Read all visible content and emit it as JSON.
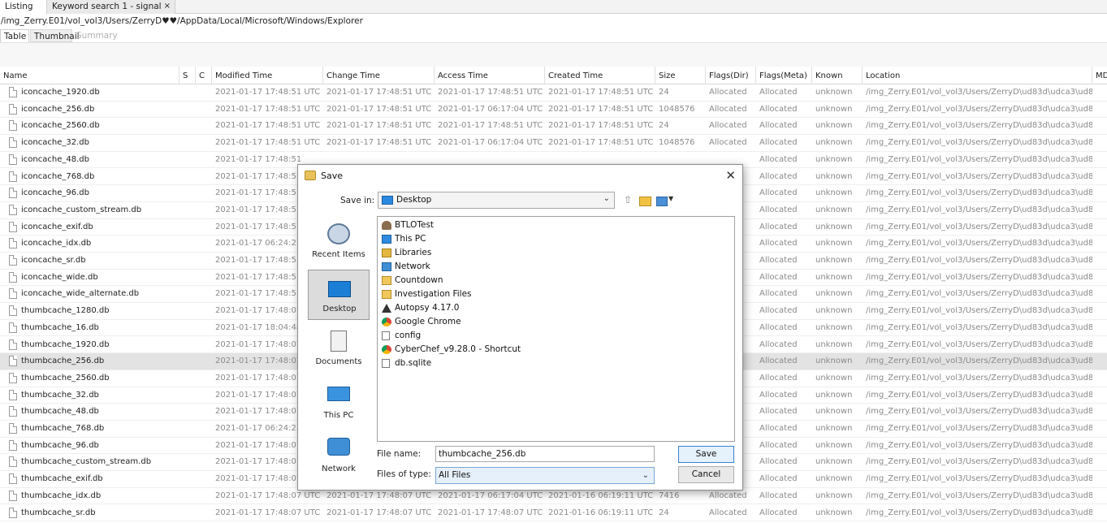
{
  "tabs": [
    {
      "label": "Listing"
    },
    {
      "label": "Keyword search 1 - signal"
    }
  ],
  "tab_close": "×",
  "path": "/img_Zerry.E01/vol_vol3/Users/ZerryD♥♥/AppData/Local/Microsoft/Windows/Explorer",
  "view_tabs": [
    "Table",
    "Thumbnail",
    "Summary"
  ],
  "columns": [
    "Name",
    "S",
    "C",
    "Modified Time",
    "Change Time",
    "Access Time",
    "Created Time",
    "Size",
    "Flags(Dir)",
    "Flags(Meta)",
    "Known",
    "Location",
    "MD"
  ],
  "rows": [
    {
      "name": "iconcache_1920.db",
      "mod": "2021-01-17 17:48:51 UTC",
      "chg": "2021-01-17 17:48:51 UTC",
      "acc": "2021-01-17 17:48:51 UTC",
      "cre": "2021-01-17 17:48:51 UTC",
      "size": "24",
      "fdir": "Allocated",
      "fmeta": "Allocated",
      "known": "unknown",
      "loc": "/img_Zerry.E01/vol_vol3/Users/ZerryD\\ud83d\\udca3\\ud83..."
    },
    {
      "name": "iconcache_256.db",
      "mod": "2021-01-17 17:48:51 UTC",
      "chg": "2021-01-17 17:48:51 UTC",
      "acc": "2021-01-17 06:17:04 UTC",
      "cre": "2021-01-17 17:48:51 UTC",
      "size": "1048576",
      "fdir": "Allocated",
      "fmeta": "Allocated",
      "known": "unknown",
      "loc": "/img_Zerry.E01/vol_vol3/Users/ZerryD\\ud83d\\udca3\\ud83..."
    },
    {
      "name": "iconcache_2560.db",
      "mod": "2021-01-17 17:48:51 UTC",
      "chg": "2021-01-17 17:48:51 UTC",
      "acc": "2021-01-17 17:48:51 UTC",
      "cre": "2021-01-17 17:48:51 UTC",
      "size": "24",
      "fdir": "Allocated",
      "fmeta": "Allocated",
      "known": "unknown",
      "loc": "/img_Zerry.E01/vol_vol3/Users/ZerryD\\ud83d\\udca3\\ud83..."
    },
    {
      "name": "iconcache_32.db",
      "mod": "2021-01-17 17:48:51 UTC",
      "chg": "2021-01-17 17:48:51 UTC",
      "acc": "2021-01-17 06:17:04 UTC",
      "cre": "2021-01-17 17:48:51 UTC",
      "size": "1048576",
      "fdir": "Allocated",
      "fmeta": "Allocated",
      "known": "unknown",
      "loc": "/img_Zerry.E01/vol_vol3/Users/ZerryD\\ud83d\\udca3\\ud83..."
    },
    {
      "name": "iconcache_48.db",
      "mod": "2021-01-17 17:48:51",
      "chg": "",
      "acc": "",
      "cre": "",
      "size": "",
      "fdir": "",
      "fmeta": "Allocated",
      "known": "unknown",
      "loc": "/img_Zerry.E01/vol_vol3/Users/ZerryD\\ud83d\\udca3\\ud83..."
    },
    {
      "name": "iconcache_768.db",
      "mod": "2021-01-17 17:48:51",
      "chg": "",
      "acc": "",
      "cre": "",
      "size": "",
      "fdir": "",
      "fmeta": "Allocated",
      "known": "unknown",
      "loc": "/img_Zerry.E01/vol_vol3/Users/ZerryD\\ud83d\\udca3\\ud83..."
    },
    {
      "name": "iconcache_96.db",
      "mod": "2021-01-17 17:48:51",
      "chg": "",
      "acc": "",
      "cre": "",
      "size": "",
      "fdir": "",
      "fmeta": "Allocated",
      "known": "unknown",
      "loc": "/img_Zerry.E01/vol_vol3/Users/ZerryD\\ud83d\\udca3\\ud83..."
    },
    {
      "name": "iconcache_custom_stream.db",
      "mod": "2021-01-17 17:48:51",
      "chg": "",
      "acc": "",
      "cre": "",
      "size": "",
      "fdir": "",
      "fmeta": "Allocated",
      "known": "unknown",
      "loc": "/img_Zerry.E01/vol_vol3/Users/ZerryD\\ud83d\\udca3\\ud83..."
    },
    {
      "name": "iconcache_exif.db",
      "mod": "2021-01-17 17:48:51",
      "chg": "",
      "acc": "",
      "cre": "",
      "size": "",
      "fdir": "",
      "fmeta": "Allocated",
      "known": "unknown",
      "loc": "/img_Zerry.E01/vol_vol3/Users/ZerryD\\ud83d\\udca3\\ud83..."
    },
    {
      "name": "iconcache_idx.db",
      "mod": "2021-01-17 06:24:21",
      "chg": "",
      "acc": "",
      "cre": "",
      "size": "",
      "fdir": "",
      "fmeta": "Allocated",
      "known": "unknown",
      "loc": "/img_Zerry.E01/vol_vol3/Users/ZerryD\\ud83d\\udca3\\ud83..."
    },
    {
      "name": "iconcache_sr.db",
      "mod": "2021-01-17 17:48:51",
      "chg": "",
      "acc": "",
      "cre": "",
      "size": "",
      "fdir": "",
      "fmeta": "Allocated",
      "known": "unknown",
      "loc": "/img_Zerry.E01/vol_vol3/Users/ZerryD\\ud83d\\udca3\\ud83..."
    },
    {
      "name": "iconcache_wide.db",
      "mod": "2021-01-17 17:48:51",
      "chg": "",
      "acc": "",
      "cre": "",
      "size": "",
      "fdir": "",
      "fmeta": "Allocated",
      "known": "unknown",
      "loc": "/img_Zerry.E01/vol_vol3/Users/ZerryD\\ud83d\\udca3\\ud83..."
    },
    {
      "name": "iconcache_wide_alternate.db",
      "mod": "2021-01-17 17:48:51",
      "chg": "",
      "acc": "",
      "cre": "",
      "size": "",
      "fdir": "",
      "fmeta": "Allocated",
      "known": "unknown",
      "loc": "/img_Zerry.E01/vol_vol3/Users/ZerryD\\ud83d\\udca3\\ud83..."
    },
    {
      "name": "thumbcache_1280.db",
      "mod": "2021-01-17 17:48:07",
      "chg": "",
      "acc": "",
      "cre": "",
      "size": "",
      "fdir": "",
      "fmeta": "Allocated",
      "known": "unknown",
      "loc": "/img_Zerry.E01/vol_vol3/Users/ZerryD\\ud83d\\udca3\\ud83..."
    },
    {
      "name": "thumbcache_16.db",
      "mod": "2021-01-17 18:04:48",
      "chg": "",
      "acc": "",
      "cre": "",
      "size": "",
      "fdir": "",
      "fmeta": "Allocated",
      "known": "unknown",
      "loc": "/img_Zerry.E01/vol_vol3/Users/ZerryD\\ud83d\\udca3\\ud83..."
    },
    {
      "name": "thumbcache_1920.db",
      "mod": "2021-01-17 17:48:07",
      "chg": "",
      "acc": "",
      "cre": "",
      "size": "",
      "fdir": "",
      "fmeta": "Allocated",
      "known": "unknown",
      "loc": "/img_Zerry.E01/vol_vol3/Users/ZerryD\\ud83d\\udca3\\ud83..."
    },
    {
      "name": "thumbcache_256.db",
      "mod": "2021-01-17 17:48:07",
      "chg": "",
      "acc": "",
      "cre": "",
      "size": "",
      "fdir": "",
      "fmeta": "Allocated",
      "known": "unknown",
      "loc": "/img_Zerry.E01/vol_vol3/Users/ZerryD\\ud83d\\udca3\\ud83...",
      "selected": true
    },
    {
      "name": "thumbcache_2560.db",
      "mod": "2021-01-17 17:48:07",
      "chg": "",
      "acc": "",
      "cre": "",
      "size": "",
      "fdir": "",
      "fmeta": "Allocated",
      "known": "unknown",
      "loc": "/img_Zerry.E01/vol_vol3/Users/ZerryD\\ud83d\\udca3\\ud83..."
    },
    {
      "name": "thumbcache_32.db",
      "mod": "2021-01-17 17:48:07",
      "chg": "",
      "acc": "",
      "cre": "",
      "size": "",
      "fdir": "",
      "fmeta": "Allocated",
      "known": "unknown",
      "loc": "/img_Zerry.E01/vol_vol3/Users/ZerryD\\ud83d\\udca3\\ud83..."
    },
    {
      "name": "thumbcache_48.db",
      "mod": "2021-01-17 17:48:07",
      "chg": "",
      "acc": "",
      "cre": "",
      "size": "",
      "fdir": "",
      "fmeta": "Allocated",
      "known": "unknown",
      "loc": "/img_Zerry.E01/vol_vol3/Users/ZerryD\\ud83d\\udca3\\ud83..."
    },
    {
      "name": "thumbcache_768.db",
      "mod": "2021-01-17 06:24:23",
      "chg": "",
      "acc": "",
      "cre": "",
      "size": "",
      "fdir": "",
      "fmeta": "Allocated",
      "known": "unknown",
      "loc": "/img_Zerry.E01/vol_vol3/Users/ZerryD\\ud83d\\udca3\\ud83..."
    },
    {
      "name": "thumbcache_96.db",
      "mod": "2021-01-17 17:48:07",
      "chg": "",
      "acc": "",
      "cre": "",
      "size": "",
      "fdir": "",
      "fmeta": "Allocated",
      "known": "unknown",
      "loc": "/img_Zerry.E01/vol_vol3/Users/ZerryD\\ud83d\\udca3\\ud83..."
    },
    {
      "name": "thumbcache_custom_stream.db",
      "mod": "2021-01-17 17:48:07",
      "chg": "",
      "acc": "",
      "cre": "",
      "size": "",
      "fdir": "",
      "fmeta": "Allocated",
      "known": "unknown",
      "loc": "/img_Zerry.E01/vol_vol3/Users/ZerryD\\ud83d\\udca3\\ud83..."
    },
    {
      "name": "thumbcache_exif.db",
      "mod": "2021-01-17 17:48:07",
      "chg": "",
      "acc": "",
      "cre": "",
      "size": "",
      "fdir": "",
      "fmeta": "Allocated",
      "known": "unknown",
      "loc": "/img_Zerry.E01/vol_vol3/Users/ZerryD\\ud83d\\udca3\\ud83..."
    },
    {
      "name": "thumbcache_idx.db",
      "mod": "2021-01-17 17:48:07 UTC",
      "chg": "2021-01-17 17:48:07 UTC",
      "acc": "2021-01-17 06:17:04 UTC",
      "cre": "2021-01-16 06:19:11 UTC",
      "size": "7416",
      "fdir": "Allocated",
      "fmeta": "Allocated",
      "known": "unknown",
      "loc": "/img_Zerry.E01/vol_vol3/Users/ZerryD\\ud83d\\udca3\\ud83..."
    },
    {
      "name": "thumbcache_sr.db",
      "mod": "2021-01-17 17:48:07 UTC",
      "chg": "2021-01-17 17:48:07 UTC",
      "acc": "2021-01-17 17:48:07 UTC",
      "cre": "2021-01-16 06:19:11 UTC",
      "size": "24",
      "fdir": "Allocated",
      "fmeta": "Allocated",
      "known": "unknown",
      "loc": "/img_Zerry.E01/vol_vol3/Users/ZerryD\\ud83d\\udca3\\ud83..."
    }
  ],
  "dialog": {
    "title": "Save",
    "close": "✕",
    "save_in_label": "Save in:",
    "save_in_value": "Desktop",
    "places": [
      {
        "label": "Recent Items",
        "icon": "recent-items-icon"
      },
      {
        "label": "Desktop",
        "icon": "desktop-icon"
      },
      {
        "label": "Documents",
        "icon": "documents-icon"
      },
      {
        "label": "This PC",
        "icon": "this-pc-icon"
      },
      {
        "label": "Network",
        "icon": "network-icon"
      }
    ],
    "files": [
      {
        "label": "BTLOTest",
        "icon": "user-folder-icon"
      },
      {
        "label": "This PC",
        "icon": "this-pc-icon"
      },
      {
        "label": "Libraries",
        "icon": "libraries-icon"
      },
      {
        "label": "Network",
        "icon": "network-icon"
      },
      {
        "label": "Countdown",
        "icon": "folder-icon"
      },
      {
        "label": "Investigation Files",
        "icon": "folder-icon"
      },
      {
        "label": "Autopsy 4.17.0",
        "icon": "autopsy-icon"
      },
      {
        "label": "Google Chrome",
        "icon": "chrome-icon"
      },
      {
        "label": "config",
        "icon": "file-icon"
      },
      {
        "label": "CyberChef_v9.28.0 - Shortcut",
        "icon": "chrome-icon"
      },
      {
        "label": "db.sqlite",
        "icon": "file-icon"
      }
    ],
    "file_name_label": "File name:",
    "file_name_value": "thumbcache_256.db",
    "file_type_label": "Files of type:",
    "file_type_value": "All Files",
    "save_button": "Save",
    "cancel_button": "Cancel"
  }
}
